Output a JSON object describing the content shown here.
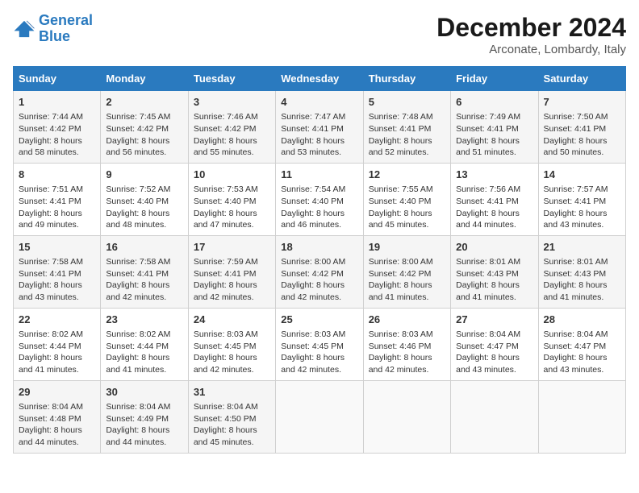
{
  "logo": {
    "line1": "General",
    "line2": "Blue"
  },
  "title": "December 2024",
  "subtitle": "Arconate, Lombardy, Italy",
  "days_header": [
    "Sunday",
    "Monday",
    "Tuesday",
    "Wednesday",
    "Thursday",
    "Friday",
    "Saturday"
  ],
  "weeks": [
    [
      {
        "day": "1",
        "info": "Sunrise: 7:44 AM\nSunset: 4:42 PM\nDaylight: 8 hours\nand 58 minutes."
      },
      {
        "day": "2",
        "info": "Sunrise: 7:45 AM\nSunset: 4:42 PM\nDaylight: 8 hours\nand 56 minutes."
      },
      {
        "day": "3",
        "info": "Sunrise: 7:46 AM\nSunset: 4:42 PM\nDaylight: 8 hours\nand 55 minutes."
      },
      {
        "day": "4",
        "info": "Sunrise: 7:47 AM\nSunset: 4:41 PM\nDaylight: 8 hours\nand 53 minutes."
      },
      {
        "day": "5",
        "info": "Sunrise: 7:48 AM\nSunset: 4:41 PM\nDaylight: 8 hours\nand 52 minutes."
      },
      {
        "day": "6",
        "info": "Sunrise: 7:49 AM\nSunset: 4:41 PM\nDaylight: 8 hours\nand 51 minutes."
      },
      {
        "day": "7",
        "info": "Sunrise: 7:50 AM\nSunset: 4:41 PM\nDaylight: 8 hours\nand 50 minutes."
      }
    ],
    [
      {
        "day": "8",
        "info": "Sunrise: 7:51 AM\nSunset: 4:41 PM\nDaylight: 8 hours\nand 49 minutes."
      },
      {
        "day": "9",
        "info": "Sunrise: 7:52 AM\nSunset: 4:40 PM\nDaylight: 8 hours\nand 48 minutes."
      },
      {
        "day": "10",
        "info": "Sunrise: 7:53 AM\nSunset: 4:40 PM\nDaylight: 8 hours\nand 47 minutes."
      },
      {
        "day": "11",
        "info": "Sunrise: 7:54 AM\nSunset: 4:40 PM\nDaylight: 8 hours\nand 46 minutes."
      },
      {
        "day": "12",
        "info": "Sunrise: 7:55 AM\nSunset: 4:40 PM\nDaylight: 8 hours\nand 45 minutes."
      },
      {
        "day": "13",
        "info": "Sunrise: 7:56 AM\nSunset: 4:41 PM\nDaylight: 8 hours\nand 44 minutes."
      },
      {
        "day": "14",
        "info": "Sunrise: 7:57 AM\nSunset: 4:41 PM\nDaylight: 8 hours\nand 43 minutes."
      }
    ],
    [
      {
        "day": "15",
        "info": "Sunrise: 7:58 AM\nSunset: 4:41 PM\nDaylight: 8 hours\nand 43 minutes."
      },
      {
        "day": "16",
        "info": "Sunrise: 7:58 AM\nSunset: 4:41 PM\nDaylight: 8 hours\nand 42 minutes."
      },
      {
        "day": "17",
        "info": "Sunrise: 7:59 AM\nSunset: 4:41 PM\nDaylight: 8 hours\nand 42 minutes."
      },
      {
        "day": "18",
        "info": "Sunrise: 8:00 AM\nSunset: 4:42 PM\nDaylight: 8 hours\nand 42 minutes."
      },
      {
        "day": "19",
        "info": "Sunrise: 8:00 AM\nSunset: 4:42 PM\nDaylight: 8 hours\nand 41 minutes."
      },
      {
        "day": "20",
        "info": "Sunrise: 8:01 AM\nSunset: 4:43 PM\nDaylight: 8 hours\nand 41 minutes."
      },
      {
        "day": "21",
        "info": "Sunrise: 8:01 AM\nSunset: 4:43 PM\nDaylight: 8 hours\nand 41 minutes."
      }
    ],
    [
      {
        "day": "22",
        "info": "Sunrise: 8:02 AM\nSunset: 4:44 PM\nDaylight: 8 hours\nand 41 minutes."
      },
      {
        "day": "23",
        "info": "Sunrise: 8:02 AM\nSunset: 4:44 PM\nDaylight: 8 hours\nand 41 minutes."
      },
      {
        "day": "24",
        "info": "Sunrise: 8:03 AM\nSunset: 4:45 PM\nDaylight: 8 hours\nand 42 minutes."
      },
      {
        "day": "25",
        "info": "Sunrise: 8:03 AM\nSunset: 4:45 PM\nDaylight: 8 hours\nand 42 minutes."
      },
      {
        "day": "26",
        "info": "Sunrise: 8:03 AM\nSunset: 4:46 PM\nDaylight: 8 hours\nand 42 minutes."
      },
      {
        "day": "27",
        "info": "Sunrise: 8:04 AM\nSunset: 4:47 PM\nDaylight: 8 hours\nand 43 minutes."
      },
      {
        "day": "28",
        "info": "Sunrise: 8:04 AM\nSunset: 4:47 PM\nDaylight: 8 hours\nand 43 minutes."
      }
    ],
    [
      {
        "day": "29",
        "info": "Sunrise: 8:04 AM\nSunset: 4:48 PM\nDaylight: 8 hours\nand 44 minutes."
      },
      {
        "day": "30",
        "info": "Sunrise: 8:04 AM\nSunset: 4:49 PM\nDaylight: 8 hours\nand 44 minutes."
      },
      {
        "day": "31",
        "info": "Sunrise: 8:04 AM\nSunset: 4:50 PM\nDaylight: 8 hours\nand 45 minutes."
      },
      {
        "day": "",
        "info": ""
      },
      {
        "day": "",
        "info": ""
      },
      {
        "day": "",
        "info": ""
      },
      {
        "day": "",
        "info": ""
      }
    ]
  ]
}
